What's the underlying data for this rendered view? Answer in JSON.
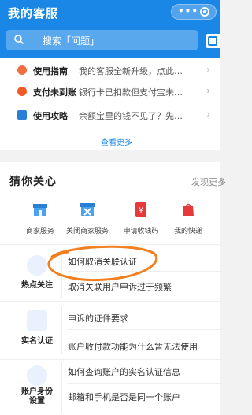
{
  "header": {
    "title": "我的客服",
    "capsule_dots": "•••",
    "search_placeholder": "搜索「问题」",
    "bg_color": "#1a86e6"
  },
  "guides": {
    "items": [
      {
        "label": "使用指南",
        "desc": "我的客服全新升级，点此…",
        "icon": "guide-icon"
      },
      {
        "label": "支付未到账",
        "desc": "银行卡已扣款但支付宝未…",
        "icon": "payment-icon"
      },
      {
        "label": "使用攻略",
        "desc": "余额宝里的钱不见了？先…",
        "icon": "document-icon"
      }
    ],
    "more": "查看更多"
  },
  "care": {
    "title": "猜你关心",
    "more": "发现更多",
    "services": [
      {
        "label": "商家服务",
        "icon": "store-icon"
      },
      {
        "label": "关闭商家服务",
        "icon": "close-store-icon"
      },
      {
        "label": "申请收钱码",
        "icon": "qr-code-icon"
      },
      {
        "label": "我的快递",
        "icon": "package-icon"
      }
    ],
    "sections": [
      {
        "category": "热点关注",
        "questions": [
          "如何取消关联认证",
          "取消关联用户申诉过于频繁"
        ],
        "icon": "hot-topic-icon"
      },
      {
        "category": "实名认证",
        "questions": [
          "申诉的证件要求",
          "账户收付款功能为什么暂无法使用"
        ],
        "icon": "id-card-icon"
      },
      {
        "category": "账户身份设置",
        "questions": [
          "如何查询账户的实名认证信息",
          "邮箱和手机是否是同一个账户"
        ],
        "icon": "account-identity-icon"
      }
    ]
  }
}
